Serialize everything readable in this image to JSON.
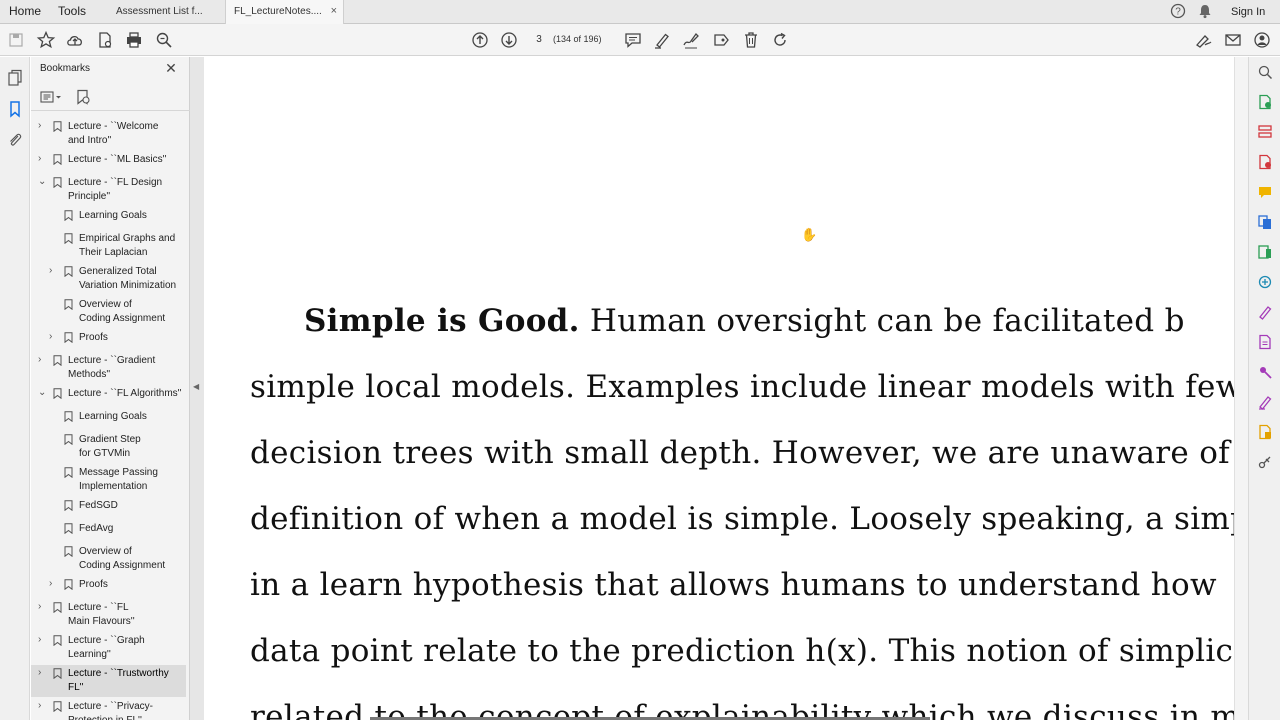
{
  "menu": {
    "home": "Home",
    "tools": "Tools",
    "sign_in": "Sign In"
  },
  "tabs": [
    {
      "label": "Assessment List f...",
      "active": false
    },
    {
      "label": "FL_LectureNotes....",
      "active": true,
      "close": "×"
    }
  ],
  "toolbar": {
    "page_value": "3",
    "page_count": "(134 of 196)"
  },
  "bookmarks": {
    "title": "Bookmarks",
    "close": "✕",
    "items": [
      {
        "text1": "Lecture - ``Welcome",
        "text2": "and Intro''",
        "level": 0,
        "chevron": "›"
      },
      {
        "text1": "Lecture - ``ML Basics''",
        "text2": "",
        "level": 0,
        "chevron": "›"
      },
      {
        "text1": "Lecture - ``FL Design",
        "text2": "Principle''",
        "level": 0,
        "chevron": "⌄"
      },
      {
        "text1": "Learning Goals",
        "text2": "",
        "level": 1,
        "chevron": ""
      },
      {
        "text1": "Empirical Graphs and",
        "text2": "Their Laplacian",
        "level": 1,
        "chevron": ""
      },
      {
        "text1": "Generalized Total",
        "text2": "Variation Minimization",
        "level": 1,
        "chevron": "›"
      },
      {
        "text1": "Overview of",
        "text2": "Coding Assignment",
        "level": 1,
        "chevron": ""
      },
      {
        "text1": "Proofs",
        "text2": "",
        "level": 1,
        "chevron": "›"
      },
      {
        "text1": "Lecture - ``Gradient",
        "text2": "Methods''",
        "level": 0,
        "chevron": "›"
      },
      {
        "text1": "Lecture - ``FL Algorithms''",
        "text2": "",
        "level": 0,
        "chevron": "⌄"
      },
      {
        "text1": "Learning Goals",
        "text2": "",
        "level": 1,
        "chevron": ""
      },
      {
        "text1": "Gradient Step",
        "text2": "for GTVMin",
        "level": 1,
        "chevron": ""
      },
      {
        "text1": "Message Passing",
        "text2": "Implementation",
        "level": 1,
        "chevron": ""
      },
      {
        "text1": "FedSGD",
        "text2": "",
        "level": 1,
        "chevron": ""
      },
      {
        "text1": "FedAvg",
        "text2": "",
        "level": 1,
        "chevron": ""
      },
      {
        "text1": "Overview of",
        "text2": "Coding Assignment",
        "level": 1,
        "chevron": ""
      },
      {
        "text1": "Proofs",
        "text2": "",
        "level": 1,
        "chevron": "›"
      },
      {
        "text1": "Lecture - ``FL",
        "text2": "Main Flavours''",
        "level": 0,
        "chevron": "›"
      },
      {
        "text1": "Lecture - ``Graph",
        "text2": "Learning''",
        "level": 0,
        "chevron": "›"
      },
      {
        "text1": "Lecture - ``Trustworthy",
        "text2": "FL''",
        "level": 0,
        "chevron": "›",
        "selected": true
      },
      {
        "text1": "Lecture - ``Privacy-",
        "text2": "Protection in FL''",
        "level": 0,
        "chevron": "›"
      }
    ]
  },
  "document": {
    "lines": [
      {
        "bold": "Simple is Good.",
        "rest": "  Human oversight can be facilitated b"
      },
      {
        "bold": "",
        "rest": "simple local models.  Examples include linear models with few"
      },
      {
        "bold": "",
        "rest": "decision trees with small depth.  However, we are unaware of a wid"
      },
      {
        "bold": "",
        "rest": "definition of when a model is simple.  Loosely speaking, a simple"
      },
      {
        "bold": "",
        "rest": "in a learn hypothesis that allows humans to understand how"
      },
      {
        "bold": "",
        "rest": "data point relate to the prediction h(x).  This notion of simplic"
      },
      {
        "bold": "",
        "rest": "related to the concept of explainability which we discuss in m"
      }
    ]
  },
  "icons": {
    "left_rail": [
      "pages-icon",
      "bookmark-icon",
      "attachment-icon"
    ],
    "right_rail": [
      "zoom-icon",
      "export-pdf-icon",
      "organize-pages-icon",
      "create-pdf-icon",
      "comment-icon",
      "combine-files-icon",
      "edit-pdf-icon",
      "compress-icon",
      "fill-sign-icon",
      "request-signature-icon",
      "protect-icon",
      "send-for-signature-icon",
      "more-tools-icon",
      "redact-icon"
    ]
  }
}
